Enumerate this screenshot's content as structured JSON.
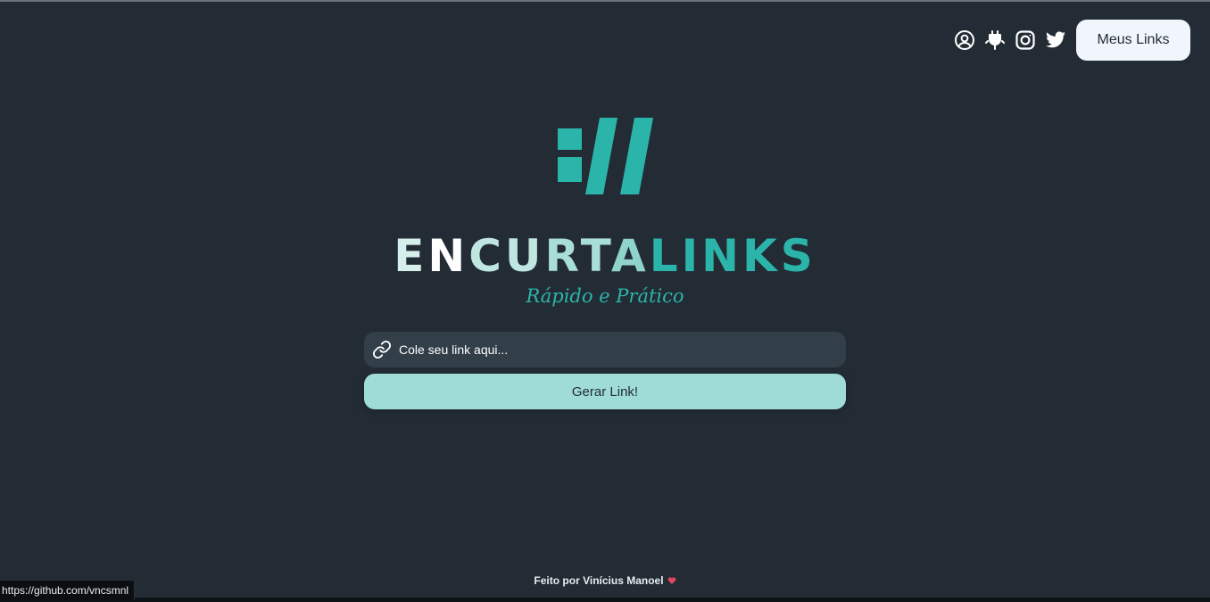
{
  "header": {
    "my_links_label": "Meus Links",
    "icons": [
      "user-circle-icon",
      "plug-icon",
      "instagram-icon",
      "twitter-icon"
    ]
  },
  "brand": {
    "name_parts": [
      "E",
      "N",
      "CU",
      "RT",
      "A",
      "LINKS"
    ],
    "tagline": "Rápido e Prático",
    "colors": {
      "primary": "#2bb5aa",
      "light": "#9fdcd7",
      "background": "#232c35"
    }
  },
  "form": {
    "placeholder": "Cole seu link aqui...",
    "value": "",
    "submit_label": "Gerar Link!"
  },
  "footer": {
    "text": "Feito por Vinícius Manoel"
  },
  "status_bar": {
    "url": "https://github.com/vncsmnl"
  }
}
